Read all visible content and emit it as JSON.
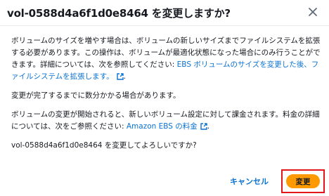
{
  "dialog": {
    "title": "vol-0588d4a6f1d0e8464 を変更しますか?",
    "close_icon": "close-icon"
  },
  "body": {
    "p1_text": "ボリュームのサイズを増やす場合は、ボリュームの新しいサイズまでファイルシステムを拡張する必要があります。この操作は、ボリュームが最適化状態になった場合にのみ行うことができます。詳細については、次を参照してください: ",
    "p1_link": "EBS ボリュームのサイズを変更した後、ファイルシステムを拡張します。",
    "p1_end": ".",
    "p2_text": "変更が完了するまでに数分かかる場合があります。",
    "p3_text": "ボリュームの変更が開始されると、新しいボリューム設定に対して課金されます。料金の詳細については、次をご参照ください: ",
    "p3_link": "Amazon EBS の料金",
    "p3_end": ".",
    "p4_text": "vol-0588d4a6f1d0e8464 を変更してよろしいですか?",
    "external_icon": "external-link-icon"
  },
  "footer": {
    "cancel_label": "キャンセル",
    "confirm_label": "変更"
  },
  "colors": {
    "link": "#0972d3",
    "primary_button": "#ff9900",
    "highlight": "#e3151a"
  }
}
